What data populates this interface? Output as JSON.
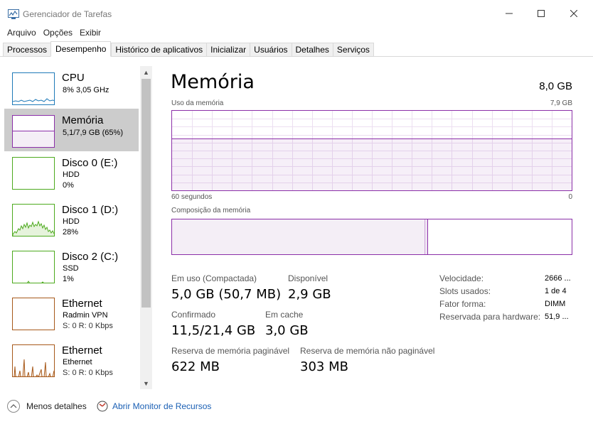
{
  "window": {
    "title": "Gerenciador de Tarefas"
  },
  "menu": [
    "Arquivo",
    "Opções",
    "Exibir"
  ],
  "tabs": [
    "Processos",
    "Desempenho",
    "Histórico de aplicativos",
    "Inicializar",
    "Usuários",
    "Detalhes",
    "Serviços"
  ],
  "active_tab": "Desempenho",
  "sidebar": {
    "items": [
      {
        "name": "CPU",
        "sub1": "8% 3,05 GHz",
        "sub2": "",
        "color": "#1f7ab8"
      },
      {
        "name": "Memória",
        "sub1": "5,1/7,9 GB (65%)",
        "sub2": "",
        "color": "#8b2fa8"
      },
      {
        "name": "Disco 0 (E:)",
        "sub1": "HDD",
        "sub2": "0%",
        "color": "#4daa1e"
      },
      {
        "name": "Disco 1 (D:)",
        "sub1": "HDD",
        "sub2": "28%",
        "color": "#4daa1e"
      },
      {
        "name": "Disco 2 (C:)",
        "sub1": "SSD",
        "sub2": "1%",
        "color": "#4daa1e"
      },
      {
        "name": "Ethernet",
        "sub1": "Radmin VPN",
        "sub2": "S: 0 R: 0 Kbps",
        "color": "#a7591a"
      },
      {
        "name": "Ethernet",
        "sub1": "Ethernet",
        "sub2": "S: 0 R: 0 Kbps",
        "color": "#a7591a"
      }
    ],
    "selected": "Memória"
  },
  "main": {
    "title": "Memória",
    "total": "8,0 GB",
    "usage_label": "Uso da memória",
    "usage_max": "7,9 GB",
    "time_left": "60 segundos",
    "time_right": "0",
    "composition_label": "Composição da memória",
    "usage_fraction": 0.65,
    "stats": {
      "in_use_label": "Em uso (Compactada)",
      "in_use_value": "5,0 GB (50,7 MB)",
      "available_label": "Disponível",
      "available_value": "2,9 GB",
      "committed_label": "Confirmado",
      "committed_value": "11,5/21,4 GB",
      "cached_label": "Em cache",
      "cached_value": "3,0 GB",
      "paged_label": "Reserva de memória paginável",
      "paged_value": "622 MB",
      "nonpaged_label": "Reserva de memória não paginável",
      "nonpaged_value": "303 MB"
    },
    "details": [
      {
        "label": "Velocidade:",
        "value": "2666 ..."
      },
      {
        "label": "Slots usados:",
        "value": "1 de 4"
      },
      {
        "label": "Fator forma:",
        "value": "DIMM"
      },
      {
        "label": "Reservada para hardware:",
        "value": "51,9 ..."
      }
    ]
  },
  "footer": {
    "fewer_details": "Menos detalhes",
    "resource_monitor": "Abrir Monitor de Recursos"
  }
}
